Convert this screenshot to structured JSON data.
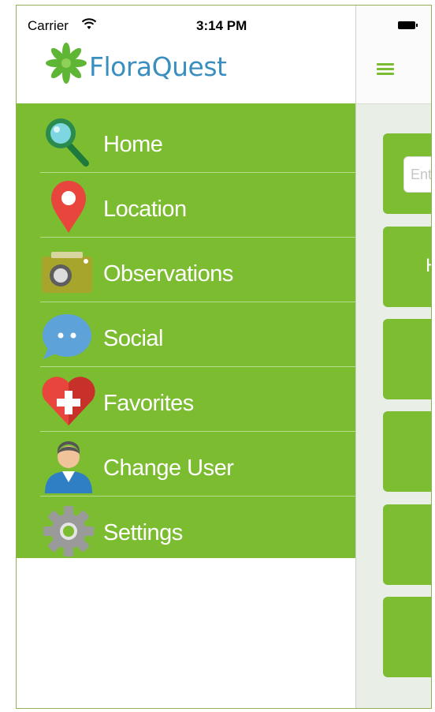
{
  "status_bar": {
    "carrier": "Carrier",
    "time": "3:14 PM"
  },
  "app": {
    "name": "FloraQuest"
  },
  "menu": {
    "items": [
      {
        "label": "Home",
        "icon": "magnifier-icon"
      },
      {
        "label": "Location",
        "icon": "map-pin-icon"
      },
      {
        "label": "Observations",
        "icon": "camera-icon"
      },
      {
        "label": "Social",
        "icon": "chat-bubble-icon"
      },
      {
        "label": "Favorites",
        "icon": "heart-plus-icon"
      },
      {
        "label": "Change User",
        "icon": "user-icon"
      },
      {
        "label": "Settings",
        "icon": "gear-icon"
      }
    ]
  },
  "main": {
    "search_placeholder": "Ent",
    "card_letter": "H"
  },
  "colors": {
    "accent_green": "#7cbc31",
    "logo_blue": "#3a8fbf",
    "pin_red": "#e8453c"
  }
}
